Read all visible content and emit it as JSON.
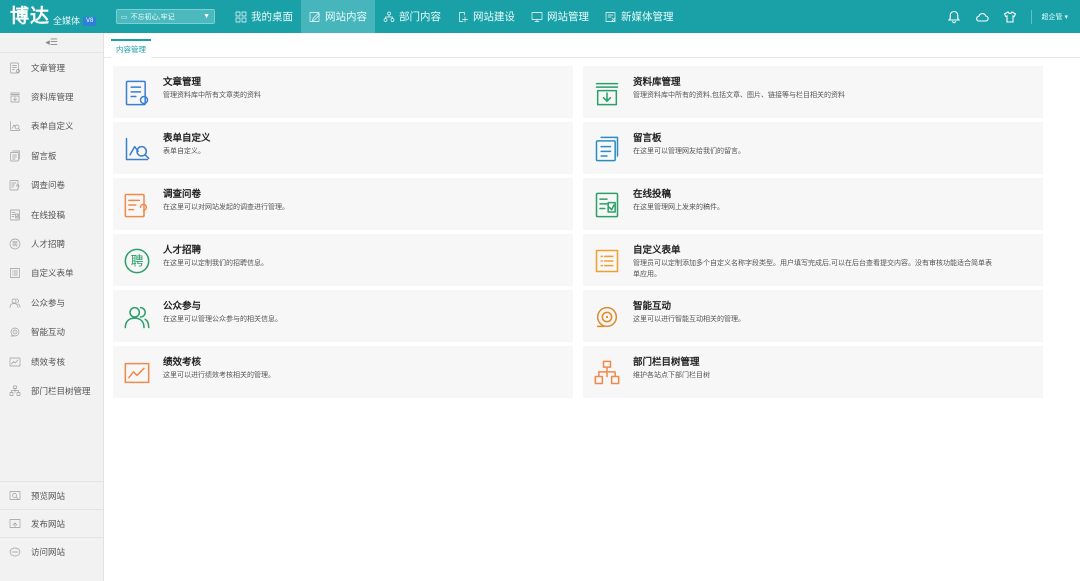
{
  "header": {
    "logo_main": "博达",
    "logo_sub": "全媒体",
    "logo_badge": "V8",
    "site_select_value": "不忘初心,牢记",
    "user_name": "超企管"
  },
  "nav": [
    {
      "label": "我的桌面",
      "icon": "grid-icon"
    },
    {
      "label": "网站内容",
      "icon": "edit-icon",
      "active": true
    },
    {
      "label": "部门内容",
      "icon": "org-icon"
    },
    {
      "label": "网站建设",
      "icon": "build-icon"
    },
    {
      "label": "网站管理",
      "icon": "monitor-icon"
    },
    {
      "label": "新媒体管理",
      "icon": "media-icon"
    }
  ],
  "top_icons": [
    "bell-icon",
    "cloud-icon",
    "shirt-icon"
  ],
  "sidebar": {
    "items": [
      {
        "label": "文章管理",
        "icon": "article-icon"
      },
      {
        "label": "资料库管理",
        "icon": "database-icon"
      },
      {
        "label": "表单自定义",
        "icon": "form-icon"
      },
      {
        "label": "留言板",
        "icon": "message-icon"
      },
      {
        "label": "调查问卷",
        "icon": "survey-icon"
      },
      {
        "label": "在线投稿",
        "icon": "submit-icon"
      },
      {
        "label": "人才招聘",
        "icon": "recruit-icon"
      },
      {
        "label": "自定义表单",
        "icon": "custom-form-icon"
      },
      {
        "label": "公众参与",
        "icon": "people-icon"
      },
      {
        "label": "智能互动",
        "icon": "robot-icon"
      },
      {
        "label": "绩效考核",
        "icon": "chart-icon"
      },
      {
        "label": "部门栏目树管理",
        "icon": "tree-icon"
      }
    ],
    "bottom": [
      {
        "label": "预览网站",
        "icon": "preview-icon"
      },
      {
        "label": "发布网站",
        "icon": "publish-icon"
      },
      {
        "label": "访问网站",
        "icon": "visit-icon"
      }
    ]
  },
  "tab": {
    "label": "内容管理"
  },
  "cards": [
    {
      "title": "文章管理",
      "desc": "管理资料库中所有文章类的资料",
      "icon": "article-icon",
      "color": "#3a7fd0"
    },
    {
      "title": "资料库管理",
      "desc": "管理资料库中所有的资料,包括文章、图片、链接等与栏目相关的资料",
      "icon": "database-icon",
      "color": "#2aa06a"
    },
    {
      "title": "表单自定义",
      "desc": "表单自定义。",
      "icon": "form-icon",
      "color": "#3a7fd0"
    },
    {
      "title": "留言板",
      "desc": "在这里可以管理网友给我们的留言。",
      "icon": "message-icon",
      "color": "#2a8fc0"
    },
    {
      "title": "调查问卷",
      "desc": "在这里可以对网站发起的调查进行管理。",
      "icon": "survey-icon",
      "color": "#f08a4b"
    },
    {
      "title": "在线投稿",
      "desc": "在这里管理网上发来的稿件。",
      "icon": "submit-icon",
      "color": "#2aa06a"
    },
    {
      "title": "人才招聘",
      "desc": "在这里可以定制我们的招聘信息。",
      "icon": "recruit-icon",
      "color": "#2aa06a"
    },
    {
      "title": "自定义表单",
      "desc": "管理员可以定制添加多个自定义名称字段类型。用户填写完成后,可以在后台查看提交内容。没有审核功能适合简单表单应用。",
      "icon": "custom-form-icon",
      "color": "#f0a030"
    },
    {
      "title": "公众参与",
      "desc": "在这里可以管理公众参与的相关信息。",
      "icon": "people-icon",
      "color": "#2aa06a"
    },
    {
      "title": "智能互动",
      "desc": "这里可以进行智能互动相关的管理。",
      "icon": "robot-icon",
      "color": "#e08a2a"
    },
    {
      "title": "绩效考核",
      "desc": "这里可以进行绩效考核相关的管理。",
      "icon": "chart-icon",
      "color": "#f08a4b"
    },
    {
      "title": "部门栏目树管理",
      "desc": "维护各站点下部门栏目树",
      "icon": "tree-icon",
      "color": "#f08a4b"
    }
  ]
}
